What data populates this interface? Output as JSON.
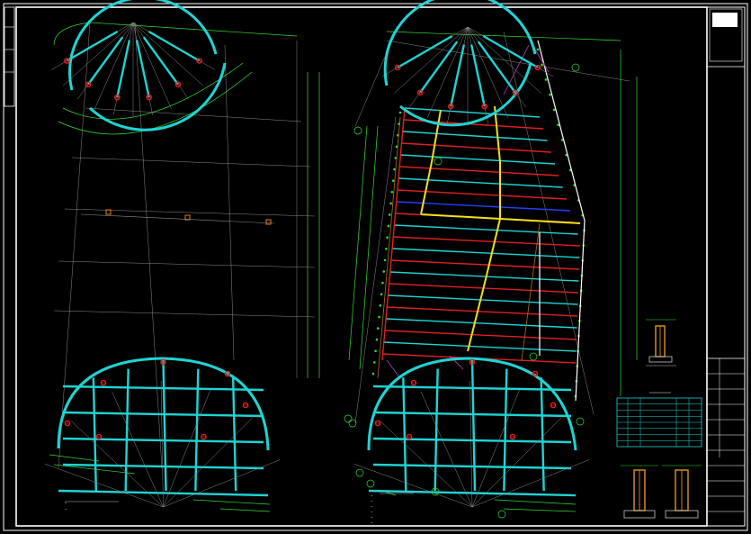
{
  "palette": {
    "background": "#000000",
    "frame": "#ffffff",
    "grid": "#8a8a8a",
    "dimension": "#33dd33",
    "beam_cyan": "#1fd4d4",
    "beam_red": "#e02020",
    "beam_yellow": "#f2e01a",
    "beam_blue": "#2240ff",
    "column_node": "#e02020",
    "accent_magenta": "#c040c0",
    "accent_orange": "#e08020"
  },
  "left_plan": {
    "notes": [
      "—",
      "—"
    ]
  },
  "right_plan": {
    "notes": [
      "—",
      "—",
      "—",
      "—",
      "—",
      "—"
    ]
  },
  "material_table": {
    "rows": 8
  },
  "title_block": {
    "rows": 10
  }
}
